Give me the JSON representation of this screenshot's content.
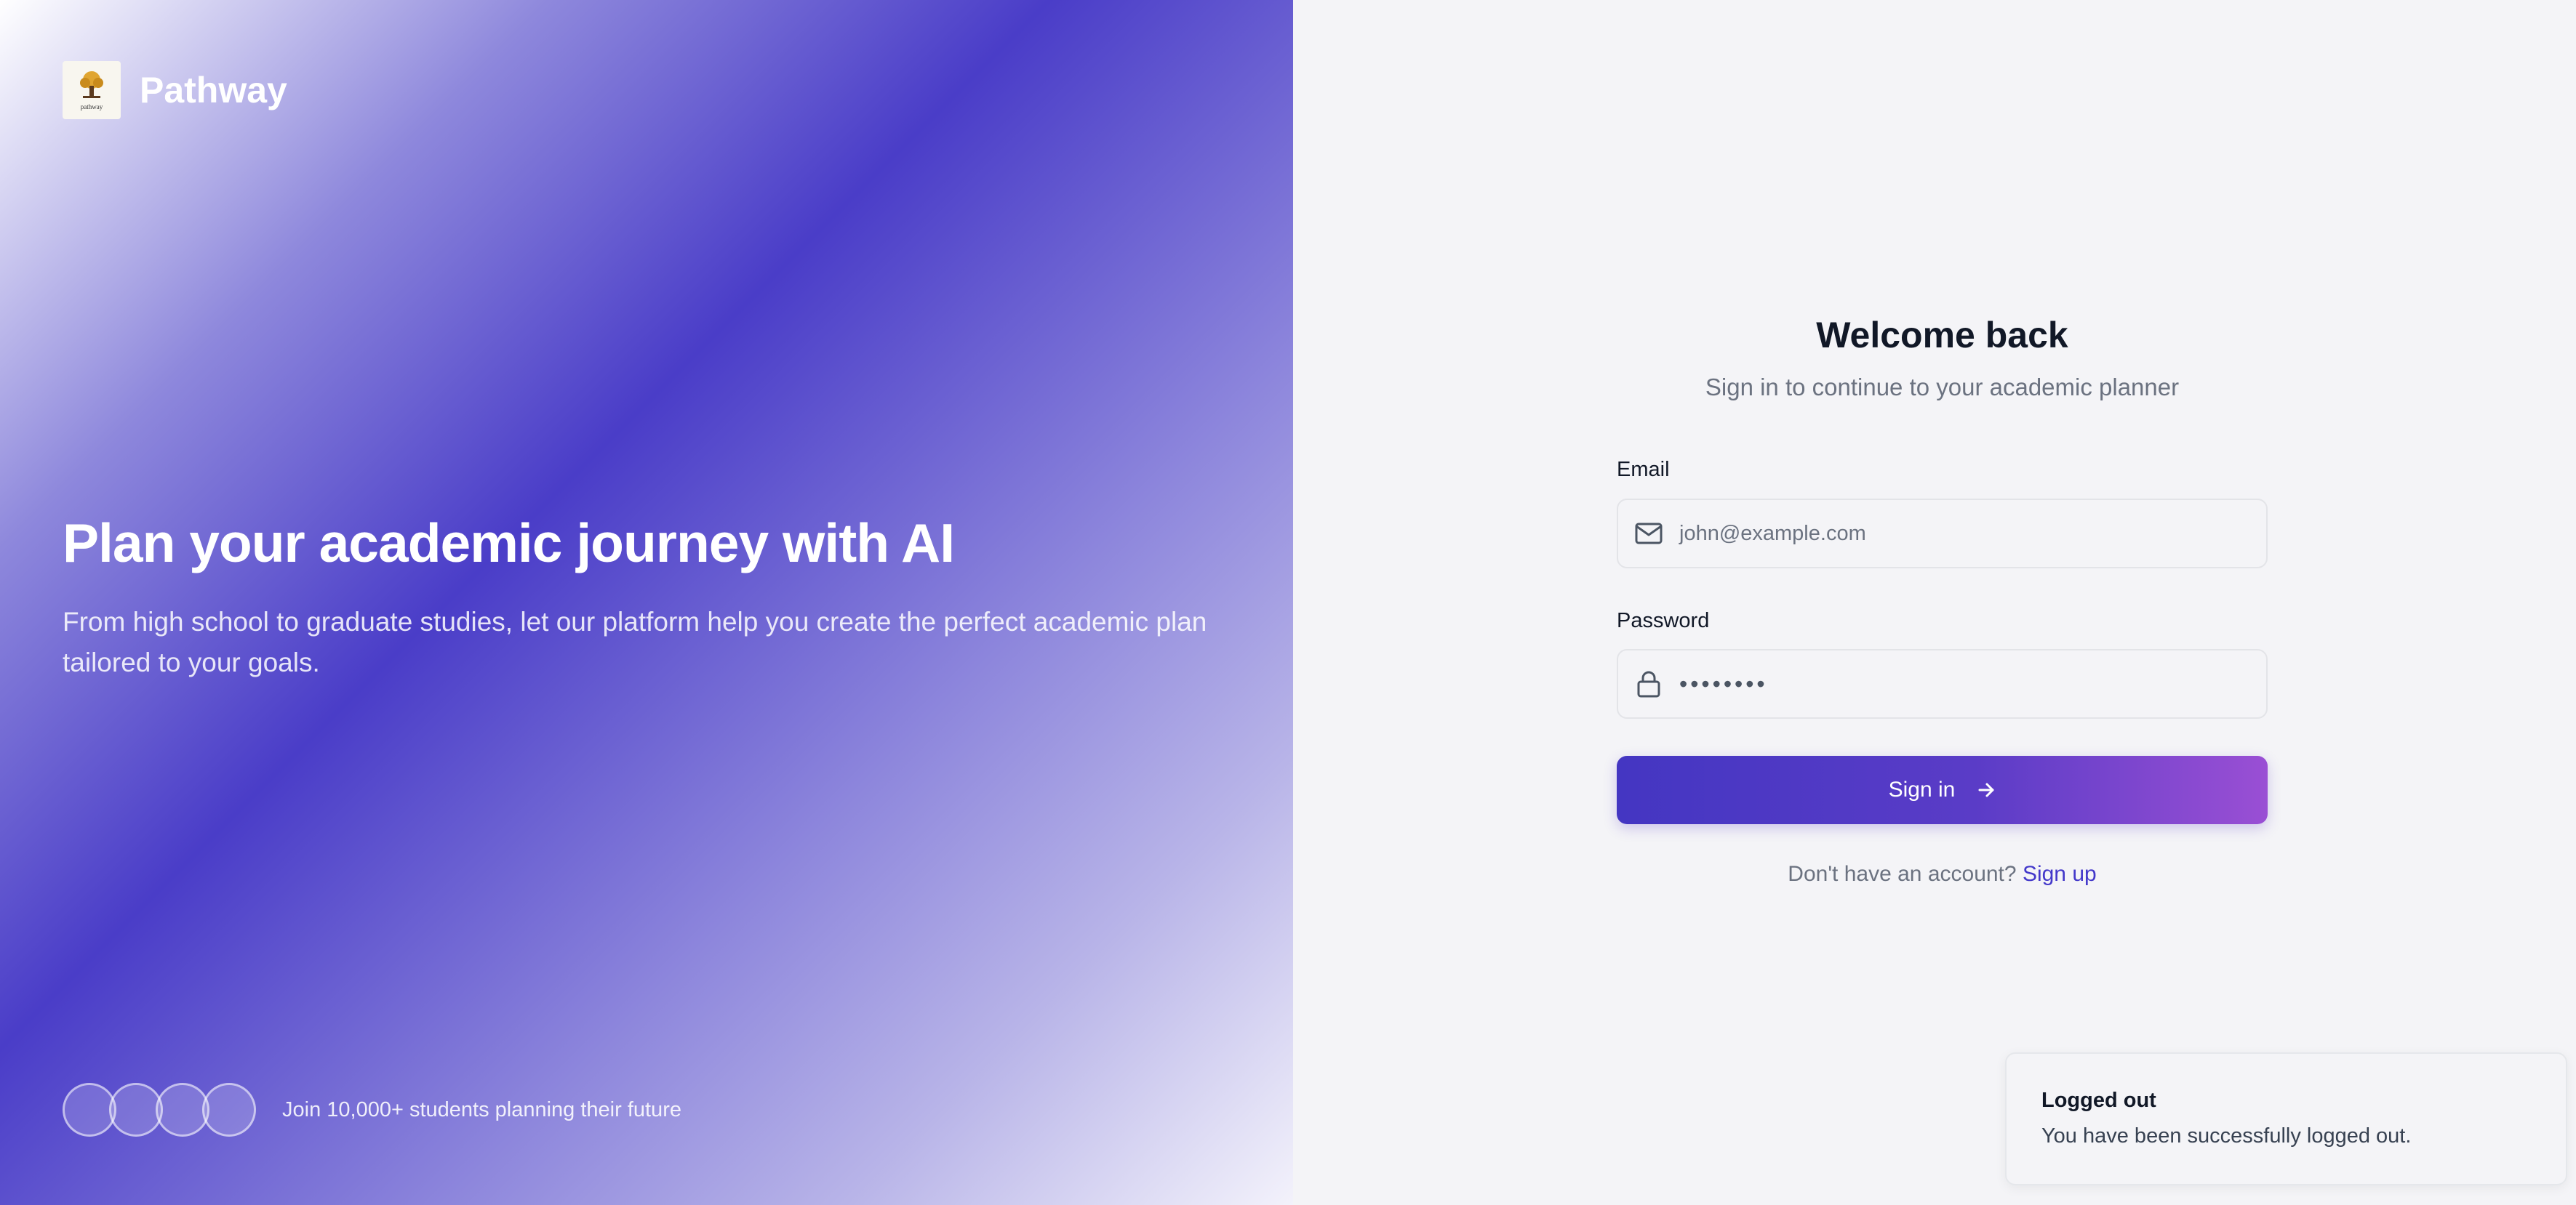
{
  "brand": {
    "name": "Pathway",
    "logo_text": "pathway",
    "logo_icon": "tree-logo-icon"
  },
  "hero": {
    "title": "Plan your academic journey with AI",
    "subtitle": "From high school to graduate studies, let our platform help you create the perfect academic plan tailored to your goals."
  },
  "social": {
    "text": "Join 10,000+ students planning their future",
    "avatar_count": 4
  },
  "login": {
    "title": "Welcome back",
    "subtitle": "Sign in to continue to your academic planner",
    "email": {
      "label": "Email",
      "placeholder": "john@example.com",
      "icon": "mail-icon"
    },
    "password": {
      "label": "Password",
      "value": "••••••••",
      "icon": "lock-icon"
    },
    "submit_label": "Sign in",
    "submit_icon": "arrow-right-icon",
    "signup_prompt": "Don't have an account?",
    "signup_link": "Sign up"
  },
  "toast": {
    "title": "Logged out",
    "message": "You have been successfully logged out."
  },
  "colors": {
    "accent": "#4338ca",
    "accent_end": "#9a4fd4",
    "panel_bg": "#f4f4f7"
  }
}
